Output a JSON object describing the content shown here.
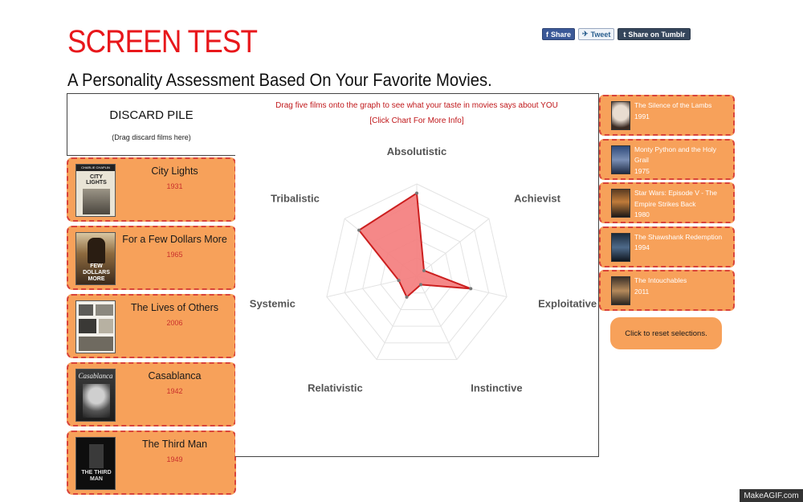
{
  "header": {
    "title": "SCREEN TEST",
    "subtitle": "A Personality Assessment Based On Your Favorite Movies."
  },
  "share": {
    "facebook": "Share",
    "twitter": "Tweet",
    "tumblr": "Share on Tumblr"
  },
  "discard_pile": {
    "title": "DISCARD PILE",
    "hint": "(Drag discard films here)"
  },
  "left_films": [
    {
      "title": "City Lights",
      "year": "1931"
    },
    {
      "title": "For a Few Dollars More",
      "year": "1965"
    },
    {
      "title": "The Lives of Others",
      "year": "2006"
    },
    {
      "title": "Casablanca",
      "year": "1942"
    },
    {
      "title": "The Third Man",
      "year": "1949"
    }
  ],
  "poster_text": {
    "city_lights_top": "CHARLIE CHAPLIN",
    "city_lights_title": "CITY LIGHTS",
    "few_dollars": "FEW DOLLARS MORE",
    "casablanca": "Casablanca",
    "third_man": "THE THIRD MAN"
  },
  "chart": {
    "instruction": "Drag five films onto the graph to see what your taste in movies says about YOU",
    "more_info": "[Click Chart For More Info]"
  },
  "chart_data": {
    "type": "radar",
    "axes": [
      "Absolutistic",
      "Achievist",
      "Exploitative",
      "Instinctive",
      "Relativistic",
      "Systemic",
      "Tribalistic"
    ],
    "values": [
      0.9,
      0.1,
      0.6,
      0.1,
      0.25,
      0.2,
      0.8
    ],
    "max": 1,
    "rings": 5,
    "fill_color": "#f47b7b",
    "stroke_color": "#cc1f1f"
  },
  "right_films": [
    {
      "title": "The Silence of the Lambs",
      "year": "1991"
    },
    {
      "title": "Monty Python and the Holy Grail",
      "year": "1975"
    },
    {
      "title": "Star Wars: Episode V - The Empire Strikes Back",
      "year": "1980"
    },
    {
      "title": "The Shawshank Redemption",
      "year": "1994"
    },
    {
      "title": "The Intouchables",
      "year": "2011"
    }
  ],
  "reset": "Click to reset selections.",
  "watermark": "MakeAGIF.com",
  "colors": {
    "title_red": "#e8171b",
    "card_orange": "#f7a15a",
    "card_border": "#d9443a",
    "year_red": "#c9302c"
  }
}
